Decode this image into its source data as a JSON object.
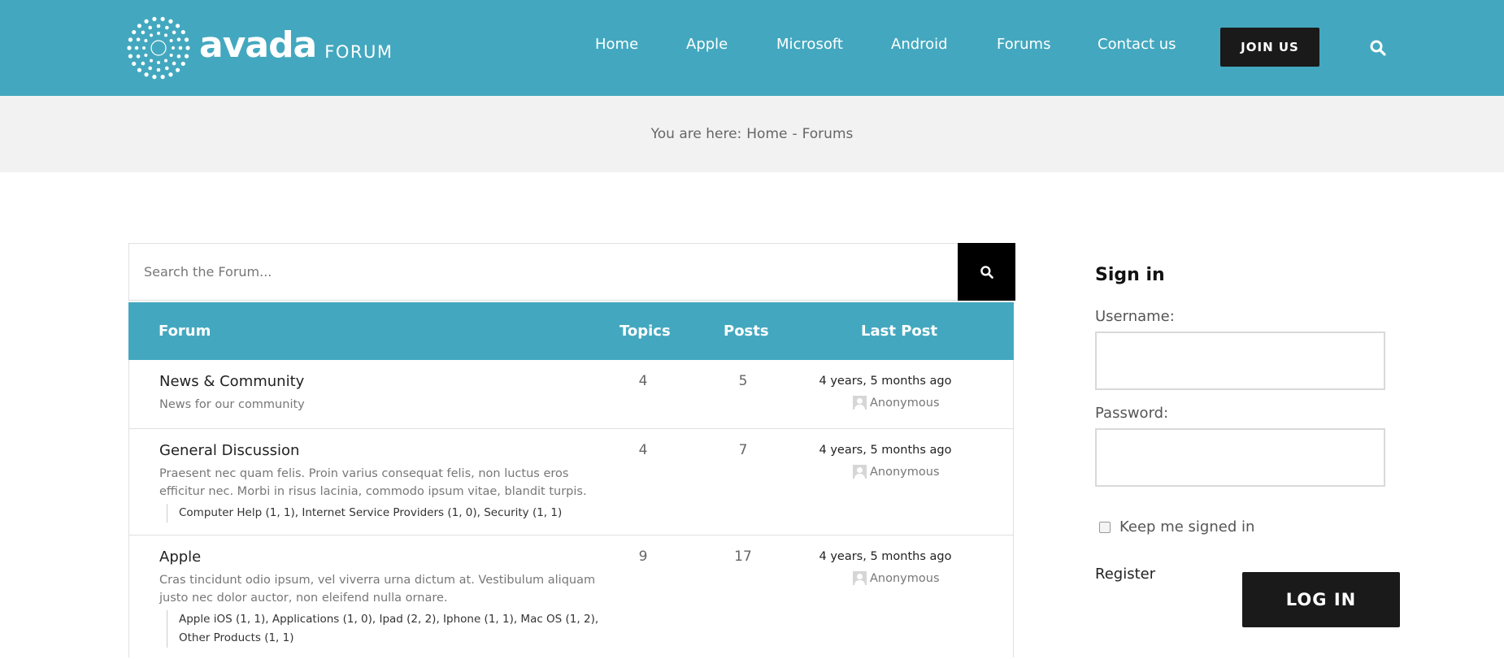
{
  "header": {
    "logo_word": "avada",
    "logo_sub": "FORUM",
    "nav": [
      "Home",
      "Apple",
      "Microsoft",
      "Android",
      "Forums",
      "Contact us"
    ],
    "join_label": "JOIN US",
    "search_icon": "search-icon"
  },
  "breadcrumb": {
    "prefix": "You are here:",
    "items": [
      "Home",
      "Forums"
    ],
    "separator": "-"
  },
  "forum_search": {
    "placeholder": "Search the Forum...",
    "button_icon": "search-icon"
  },
  "table": {
    "headers": {
      "forum": "Forum",
      "topics": "Topics",
      "posts": "Posts",
      "last_post": "Last Post"
    },
    "rows": [
      {
        "title": "News & Community",
        "description": "News for our community",
        "subforums": "",
        "topics": "4",
        "posts": "5",
        "last_post_time": "4 years, 5 months ago",
        "last_post_user": "Anonymous"
      },
      {
        "title": "General Discussion",
        "description": "Praesent nec quam felis. Proin varius consequat felis, non luctus eros efficitur nec. Morbi in risus lacinia, commodo ipsum vitae, blandit turpis.",
        "subforums": "Computer Help (1, 1), Internet Service Providers (1, 0), Security (1, 1)",
        "topics": "4",
        "posts": "7",
        "last_post_time": "4 years, 5 months ago",
        "last_post_user": "Anonymous"
      },
      {
        "title": "Apple",
        "description": "Cras tincidunt odio ipsum, vel viverra urna dictum at. Vestibulum aliquam justo nec dolor auctor, non eleifend nulla ornare.",
        "subforums": "Apple iOS (1, 1), Applications (1, 0), Ipad (2, 2), Iphone (1, 1), Mac OS (1, 2), Other Products (1, 1)",
        "topics": "9",
        "posts": "17",
        "last_post_time": "4 years, 5 months ago",
        "last_post_user": "Anonymous"
      }
    ]
  },
  "signin": {
    "title": "Sign in",
    "username_label": "Username:",
    "password_label": "Password:",
    "remember_label": "Keep me signed in",
    "register_label": "Register",
    "login_label": "LOG IN"
  },
  "colors": {
    "accent": "#43a8bf",
    "dark_button": "#1a1a1a",
    "crumb_bg": "#f2f2f2"
  }
}
